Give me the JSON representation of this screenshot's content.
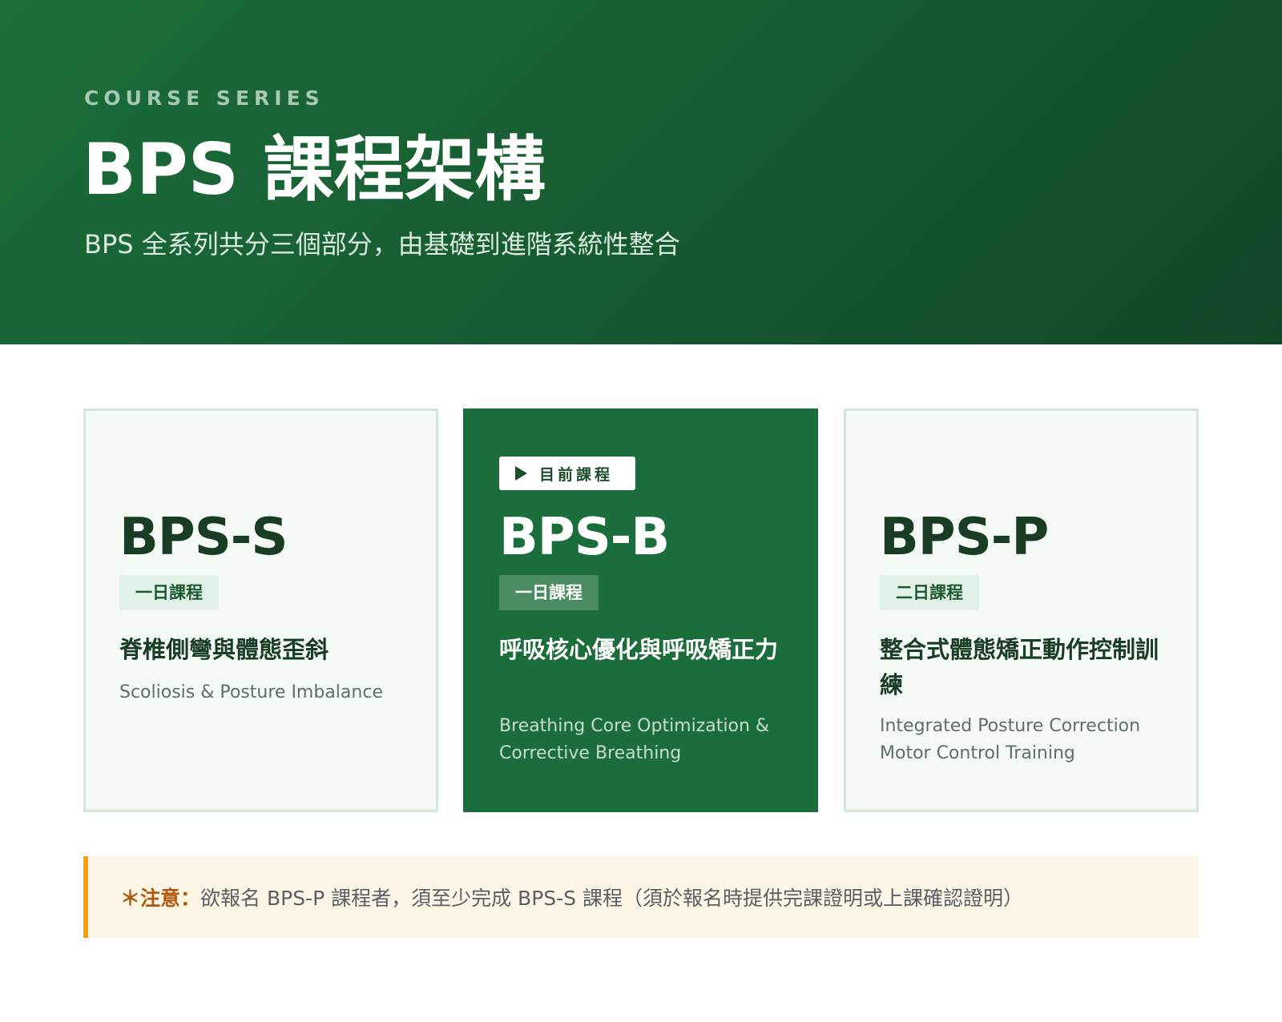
{
  "hero": {
    "eyebrow": "COURSE SERIES",
    "title": "BPS 課程架構",
    "subtitle": "BPS 全系列共分三個部分，由基礎到進階系統性整合"
  },
  "courses": [
    {
      "code": "BPS-S",
      "duration": "一日課程",
      "name_zh": "脊椎側彎與體態歪斜",
      "name_en": "Scoliosis & Posture Imbalance",
      "current": false
    },
    {
      "badge": "目前課程",
      "badge_icon": "play-icon",
      "code": "BPS-B",
      "duration": "一日課程",
      "name_zh": "呼吸核心優化與呼吸矯正力",
      "name_en": "Breathing Core Optimization & Corrective Breathing",
      "current": true
    },
    {
      "code": "BPS-P",
      "duration": "二日課程",
      "name_zh": "整合式體態矯正動作控制訓練",
      "name_en": "Integrated Posture Correction Motor Control Training",
      "current": false
    }
  ],
  "notice": {
    "label": "＊注意：",
    "text": "欲報名 BPS-P 課程者，須至少完成 BPS-S 課程（須於報名時提供完課證明或上課確認證明）"
  },
  "colors": {
    "brand_green": "#1b6e3b",
    "dark_green": "#193c25",
    "notice_accent": "#f0a21d",
    "notice_bg": "#fdf6e6"
  }
}
